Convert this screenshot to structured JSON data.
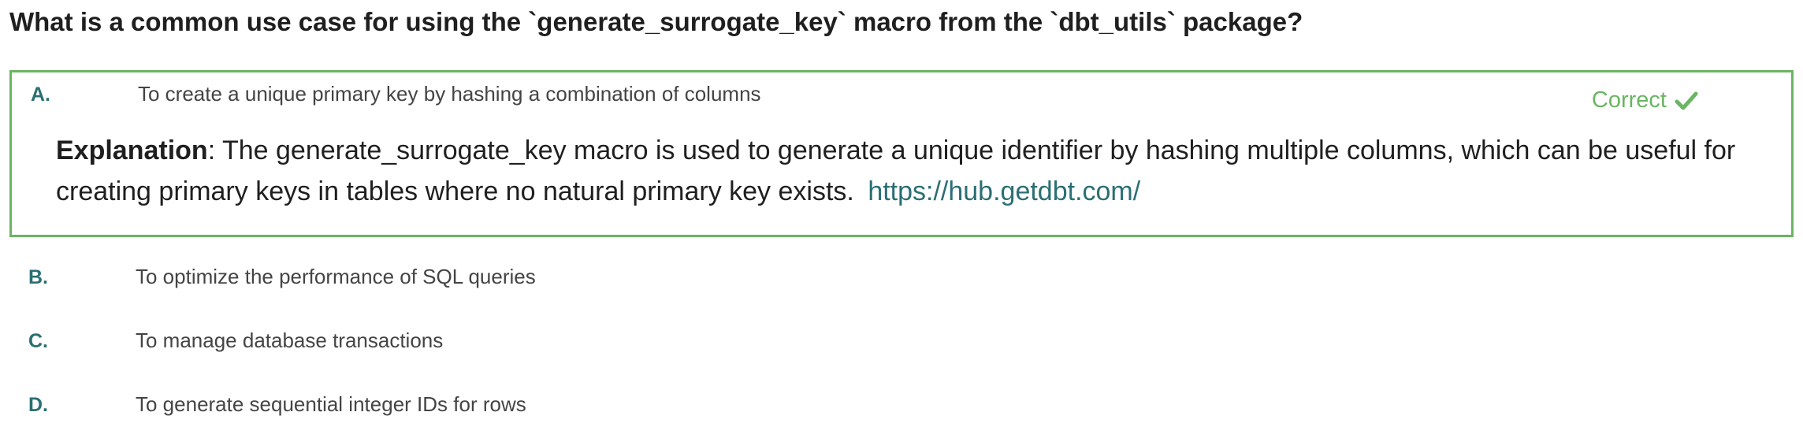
{
  "question": "What is a common use case for using the `generate_surrogate_key` macro from the `dbt_utils` package?",
  "status_label": "Correct",
  "status_icon": "checkmark-icon",
  "accent_color": "#6ab562",
  "letter_color": "#2a6f73",
  "options": [
    {
      "letter": "A.",
      "text": "To create a unique primary key by hashing a combination of columns"
    },
    {
      "letter": "B.",
      "text": "To optimize the performance of SQL queries"
    },
    {
      "letter": "C.",
      "text": "To manage database transactions"
    },
    {
      "letter": "D.",
      "text": "To generate sequential integer IDs for rows"
    }
  ],
  "explanation": {
    "label": "Explanation",
    "separator": ": ",
    "body": "The generate_surrogate_key macro is used to generate a unique identifier by hashing multiple columns, which can be useful for creating primary keys in tables where no natural primary key exists.",
    "link": "https://hub.getdbt.com/"
  }
}
